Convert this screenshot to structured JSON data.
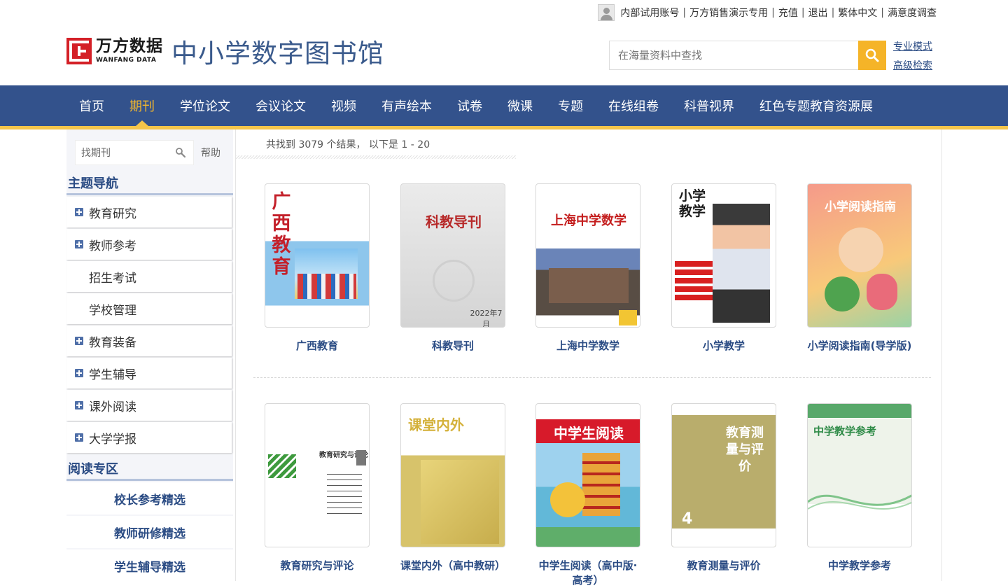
{
  "topbar": {
    "links": [
      "内部试用账号",
      "万方销售演示专用",
      "充值",
      "退出",
      "繁体中文",
      "满意度调查"
    ]
  },
  "logo": {
    "brand_cn": "万方数据",
    "brand_en": "WANFANG DATA",
    "site_title": "中小学数字图书馆"
  },
  "search": {
    "placeholder": "在海量资料中查找",
    "pro_mode": "专业模式",
    "advanced": "高级检索"
  },
  "nav": {
    "items": [
      "首页",
      "期刊",
      "学位论文",
      "会议论文",
      "视频",
      "有声绘本",
      "试卷",
      "微课",
      "专题",
      "在线组卷",
      "科普视界",
      "红色专题教育资源展"
    ],
    "active": "期刊"
  },
  "sidebar": {
    "search_placeholder": "找期刊",
    "help": "帮助",
    "topic_title": "主题导航",
    "categories": [
      "教育研究",
      "教师参考",
      "招生考试",
      "学校管理",
      "教育装备",
      "学生辅导",
      "课外阅读",
      "大学学报"
    ],
    "reading_title": "阅读专区",
    "reading_items": [
      "校长参考精选",
      "教师研修精选",
      "学生辅导精选"
    ]
  },
  "results": {
    "summary": "共找到 3079 个结果， 以下是 1 - 20"
  },
  "journals": [
    {
      "name": "广西教育",
      "cover_text": "广西教育"
    },
    {
      "name": "科教导刊",
      "cover_text": "科教导刊"
    },
    {
      "name": "上海中学数学",
      "cover_text": "上海中学数学"
    },
    {
      "name": "小学教学",
      "cover_text": "小学教学"
    },
    {
      "name": "小学阅读指南(导学版)",
      "cover_text": "小学阅读指南"
    },
    {
      "name": "教育研究与评论",
      "cover_text": "教育研究与评论"
    },
    {
      "name": "课堂内外（高中教研）",
      "cover_text": "课堂内外"
    },
    {
      "name": "中学生阅读（高中版·高考）",
      "cover_text": "中学生阅读"
    },
    {
      "name": "教育测量与评价",
      "cover_text": "教育测量与评价"
    },
    {
      "name": "中学教学参考",
      "cover_text": "中学教学参考"
    }
  ],
  "colors": {
    "nav_bg": "#33528c",
    "nav_active": "#f5b82c",
    "accent_yellow": "#f5c54a",
    "link_blue": "#2b4c84",
    "logo_red": "#d42027"
  }
}
